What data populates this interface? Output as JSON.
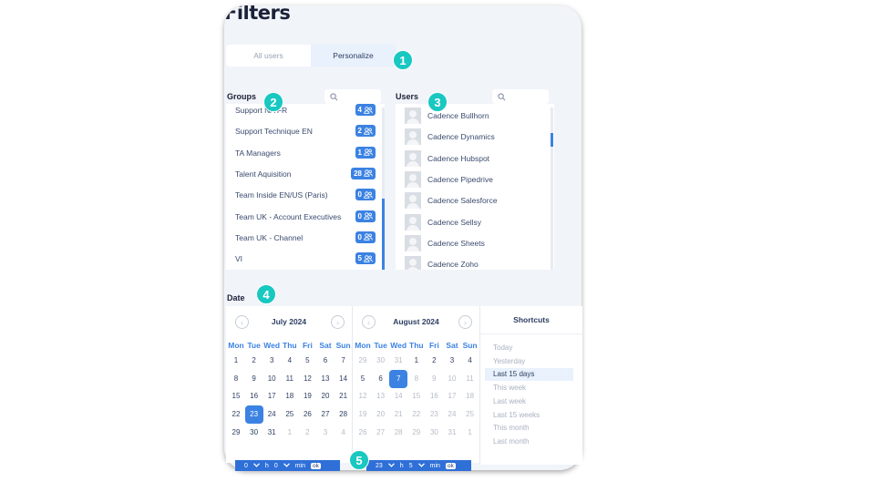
{
  "page": {
    "title": "Filters"
  },
  "tabs": [
    {
      "label": "All users",
      "active": false
    },
    {
      "label": "Personalize",
      "active": true
    }
  ],
  "markers": [
    "1",
    "2",
    "3",
    "4",
    "5"
  ],
  "groups": {
    "label": "Groups",
    "items": [
      {
        "name": "Support NA FR",
        "count": "4"
      },
      {
        "name": "Support Technique EN",
        "count": "2"
      },
      {
        "name": "TA Managers",
        "count": "1"
      },
      {
        "name": "Talent Aquisition",
        "count": "28"
      },
      {
        "name": "Team Inside EN/US (Paris)",
        "count": "0"
      },
      {
        "name": "Team UK - Account Executives",
        "count": "0"
      },
      {
        "name": "Team UK - Channel",
        "count": "0"
      },
      {
        "name": "VI",
        "count": "5"
      }
    ]
  },
  "users": {
    "label": "Users",
    "items": [
      "Cadence Bullhorn",
      "Cadence Dynamics",
      "Cadence Hubspot",
      "Cadence Pipedrive",
      "Cadence Salesforce",
      "Cadence Sellsy",
      "Cadence Sheets",
      "Cadence Zoho"
    ]
  },
  "date": {
    "label": "Date",
    "weekdays": [
      "Mon",
      "Tue",
      "Wed",
      "Thu",
      "Fri",
      "Sat",
      "Sun"
    ],
    "months": [
      {
        "title": "July 2024",
        "days": [
          [
            "1",
            "2",
            "3",
            "4",
            "5",
            "6",
            "7"
          ],
          [
            "8",
            "9",
            "10",
            "11",
            "12",
            "13",
            "14"
          ],
          [
            "15",
            "16",
            "17",
            "18",
            "19",
            "20",
            "21"
          ],
          [
            "22",
            "23",
            "24",
            "25",
            "26",
            "27",
            "28"
          ],
          [
            "29",
            "30",
            "31",
            "1",
            "2",
            "3",
            "4"
          ]
        ],
        "muted": [
          [
            4,
            3
          ],
          [
            4,
            4
          ],
          [
            4,
            5
          ],
          [
            4,
            6
          ]
        ],
        "selected": [
          3,
          1
        ],
        "time": {
          "hour": "0",
          "hour_unit": "h",
          "min": "0",
          "min_unit": "min",
          "ok": "ok"
        }
      },
      {
        "title": "August 2024",
        "days": [
          [
            "29",
            "30",
            "31",
            "1",
            "2",
            "3",
            "4"
          ],
          [
            "5",
            "6",
            "7",
            "8",
            "9",
            "10",
            "11"
          ],
          [
            "12",
            "13",
            "14",
            "15",
            "16",
            "17",
            "18"
          ],
          [
            "19",
            "20",
            "21",
            "22",
            "23",
            "24",
            "25"
          ],
          [
            "26",
            "27",
            "28",
            "29",
            "30",
            "31",
            "1"
          ]
        ],
        "muted": [
          [
            0,
            0
          ],
          [
            0,
            1
          ],
          [
            0,
            2
          ],
          [
            1,
            3
          ],
          [
            1,
            4
          ],
          [
            1,
            5
          ],
          [
            1,
            6
          ],
          [
            2,
            0
          ],
          [
            2,
            1
          ],
          [
            2,
            2
          ],
          [
            2,
            3
          ],
          [
            2,
            4
          ],
          [
            2,
            5
          ],
          [
            2,
            6
          ],
          [
            3,
            0
          ],
          [
            3,
            1
          ],
          [
            3,
            2
          ],
          [
            3,
            3
          ],
          [
            3,
            4
          ],
          [
            3,
            5
          ],
          [
            3,
            6
          ],
          [
            4,
            0
          ],
          [
            4,
            1
          ],
          [
            4,
            2
          ],
          [
            4,
            3
          ],
          [
            4,
            4
          ],
          [
            4,
            5
          ],
          [
            4,
            6
          ]
        ],
        "selected": [
          1,
          2
        ],
        "time": {
          "hour": "23",
          "hour_unit": "h",
          "min": "5",
          "min_unit": "min",
          "ok": "ok"
        }
      }
    ],
    "shortcuts": {
      "title": "Shortcuts",
      "items": [
        {
          "label": "Today",
          "active": false
        },
        {
          "label": "Yesterday",
          "active": false
        },
        {
          "label": "Last 15 days",
          "active": true
        },
        {
          "label": "This week",
          "active": false
        },
        {
          "label": "Last week",
          "active": false
        },
        {
          "label": "Last 15 weeks",
          "active": false
        },
        {
          "label": "This month",
          "active": false
        },
        {
          "label": "Last month",
          "active": false
        }
      ]
    }
  },
  "colors": {
    "accent": "#3b82e3",
    "marker": "#18c8c1"
  }
}
